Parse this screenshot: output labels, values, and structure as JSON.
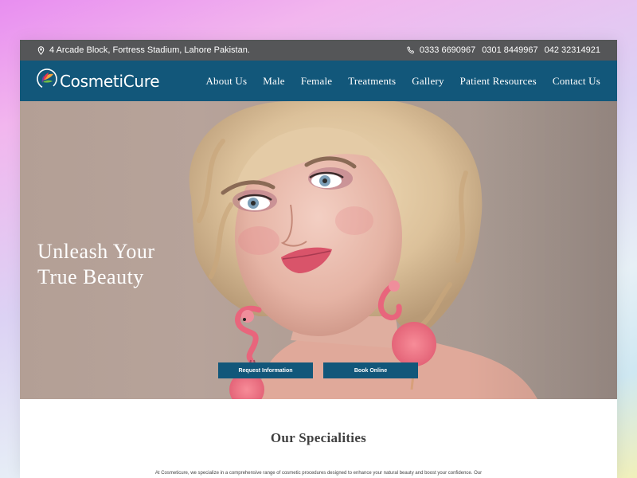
{
  "topbar": {
    "address": "4 Arcade Block, Fortress Stadium, Lahore Pakistan.",
    "phones": [
      "0333 6690967",
      "0301 8449967",
      "042 32314921"
    ]
  },
  "brand": {
    "name": "CosmetiCure"
  },
  "nav": {
    "items": [
      "About Us",
      "Male",
      "Female",
      "Treatments",
      "Gallery",
      "Patient Resources",
      "Contact Us"
    ]
  },
  "hero": {
    "title_line1": "Unleash Your",
    "title_line2": "True Beauty",
    "request_button": "Request Information",
    "book_button": "Book Online"
  },
  "specialities": {
    "title": "Our Specialities",
    "text": "At Cosmeticure, we specialize in a comprehensive range of cosmetic procedures designed to enhance your natural beauty and boost your confidence. Our"
  },
  "colors": {
    "primary": "#12577a",
    "topbar": "#555658",
    "accent_pink": "#e8657c"
  },
  "icons": {
    "address": "map-pin-icon",
    "phone": "phone-icon",
    "logo": "leaf-logo-icon"
  }
}
